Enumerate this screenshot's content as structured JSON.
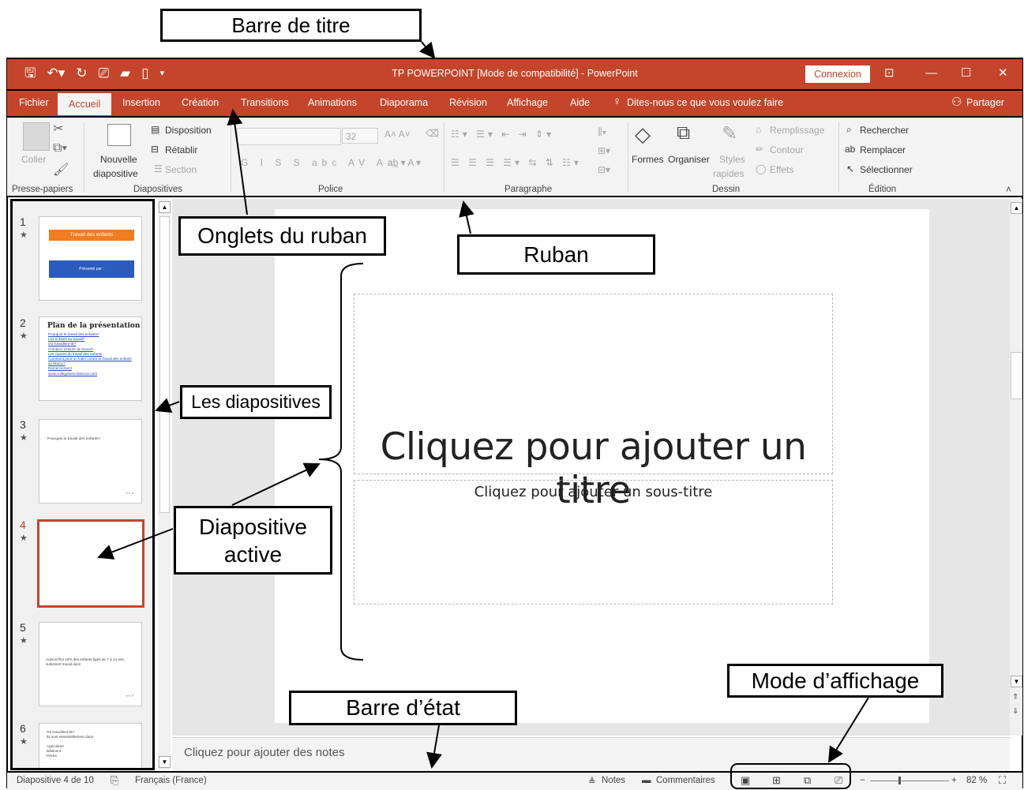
{
  "annotations": {
    "barre_titre": "Barre de titre",
    "onglets": "Onglets du ruban",
    "ruban": "Ruban",
    "diapositives": "Les diapositives",
    "active_line1": "Diapositive",
    "active_line2": "active",
    "mode": "Mode d’affichage",
    "barre_etat": "Barre d’état"
  },
  "titlebar": {
    "title": "TP POWERPOINT [Mode de compatibilité]  -  PowerPoint",
    "connexion": "Connexion"
  },
  "tabs": [
    "Fichier",
    "Accueil",
    "Insertion",
    "Création",
    "Transitions",
    "Animations",
    "Diaporama",
    "Révision",
    "Affichage",
    "Aide"
  ],
  "tell_me": "Dites-nous ce que vous voulez faire",
  "share": "Partager",
  "ribbon": {
    "coller": "Coller",
    "nouvelle": "Nouvelle",
    "diapositive": "diapositive",
    "disposition": "Disposition",
    "retablir": "Rétablir",
    "section": "Section",
    "font_size": "32",
    "formes": "Formes",
    "organiser": "Organiser",
    "styles": "Styles",
    "rapides": "rapides",
    "remplissage": "Remplissage",
    "contour": "Contour",
    "effets": "Effets",
    "rechercher": "Rechercher",
    "remplacer": "Remplacer",
    "selectionner": "Sélectionner",
    "groups": [
      "Presse-papiers",
      "Diapositives",
      "Police",
      "Paragraphe",
      "Dessin",
      "Édition"
    ]
  },
  "slides": {
    "numbers": [
      "1",
      "2",
      "3",
      "4",
      "5",
      "6"
    ],
    "s1_title": "Travail des enfants",
    "s1_sub": "Présenté par :",
    "s2_title": "Plan de la présentation",
    "s2_items": [
      "Pourquoi le travail des enfants?",
      "Les enfants au travail?",
      "Où travaillent-ils?",
      "Combien d'heure de travail?",
      "Les causes du travail des enfants",
      "Comment peut-on lutter contre le travail des enfants au Maroc?",
      "Remerciement",
      "www.collegebenchakroun.com"
    ],
    "s3_text": "Pourquoi le travail des enfants?",
    "s5_text": "Aujourd'hui 13% des enfants âgés de 7 à 14 ans, subissent travail dans",
    "s6_line1": "Où travaillent-ils?",
    "s6_line2": "Ils sont essentiellement dans:",
    "s6_items": [
      "Agriculture",
      "Bâtiment",
      "Pêche"
    ]
  },
  "main_slide": {
    "title": "Cliquez pour ajouter un titre",
    "subtitle": "Cliquez pour ajouter un sous-titre"
  },
  "notes": "Cliquez pour ajouter des notes",
  "status": {
    "slide": "Diapositive 4 de 10",
    "lang": "Français (France)",
    "notes": "Notes",
    "comments": "Commentaires",
    "zoom": "82 %"
  },
  "colors": {
    "accent": "#c4452b",
    "ribbon": "#f3f3f3"
  }
}
